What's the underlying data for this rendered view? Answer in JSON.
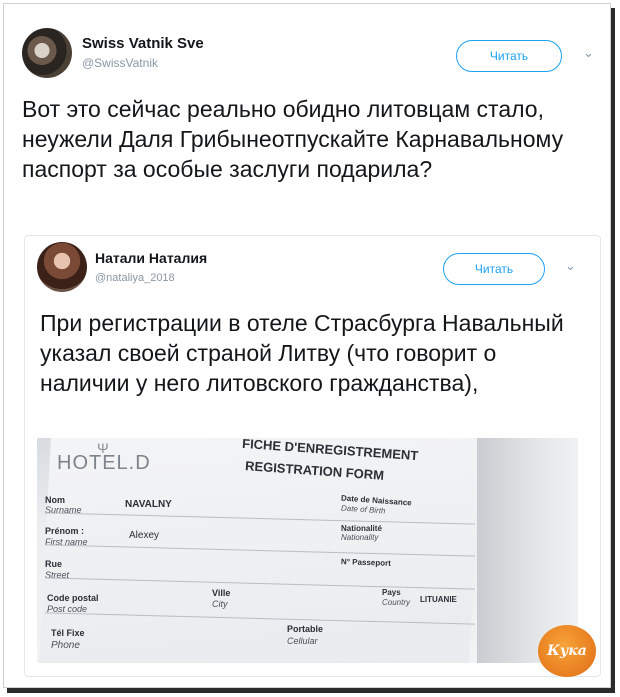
{
  "tweet": {
    "author_name": "Swiss Vatnik Sve",
    "author_handle": "@SwissVatnik",
    "follow_label": "Читать",
    "text": "Вот это сейчас реально обидно литовцам стало, неужели Даля Грибынеотпускайте Карнавальному паспорт за особые заслуги подарила?"
  },
  "quoted": {
    "author_name": "Натали Наталия",
    "author_handle": "@nataliya_2018",
    "follow_label": "Читать",
    "text": "При регистрации в отеле Страсбурга Навальный указал своей страной Литву (что говорит о наличии у него литовского гражданства),"
  },
  "photo": {
    "hotel": "HOTEL.D",
    "form_title_fr": "FICHE D'ENREGISTREMENT",
    "form_title_en": "REGISTRATION FORM",
    "nom": "Nom",
    "surname": "Surname",
    "nom_value": "NAVALNY",
    "prenom": "Prénom :",
    "first_name": "First name",
    "prenom_value": "Alexey",
    "rue": "Rue",
    "street": "Street",
    "code_postal": "Code postal",
    "post_code": "Post code",
    "tel_fixe": "Tél Fixe",
    "phone": "Phone",
    "ville": "Ville",
    "city": "City",
    "portable": "Portable",
    "cellular": "Cellular",
    "date_naissance": "Date de Naissance",
    "date_birth": "Date of Birth",
    "nationalite": "Nationalité",
    "nationality": "Nationality",
    "passeport": "N° Passeport",
    "pays": "Pays",
    "country": "Country",
    "pays_value": "LITUANIE"
  },
  "watermark": "Кука",
  "icons": {
    "chevron": "chevron-down-icon"
  }
}
